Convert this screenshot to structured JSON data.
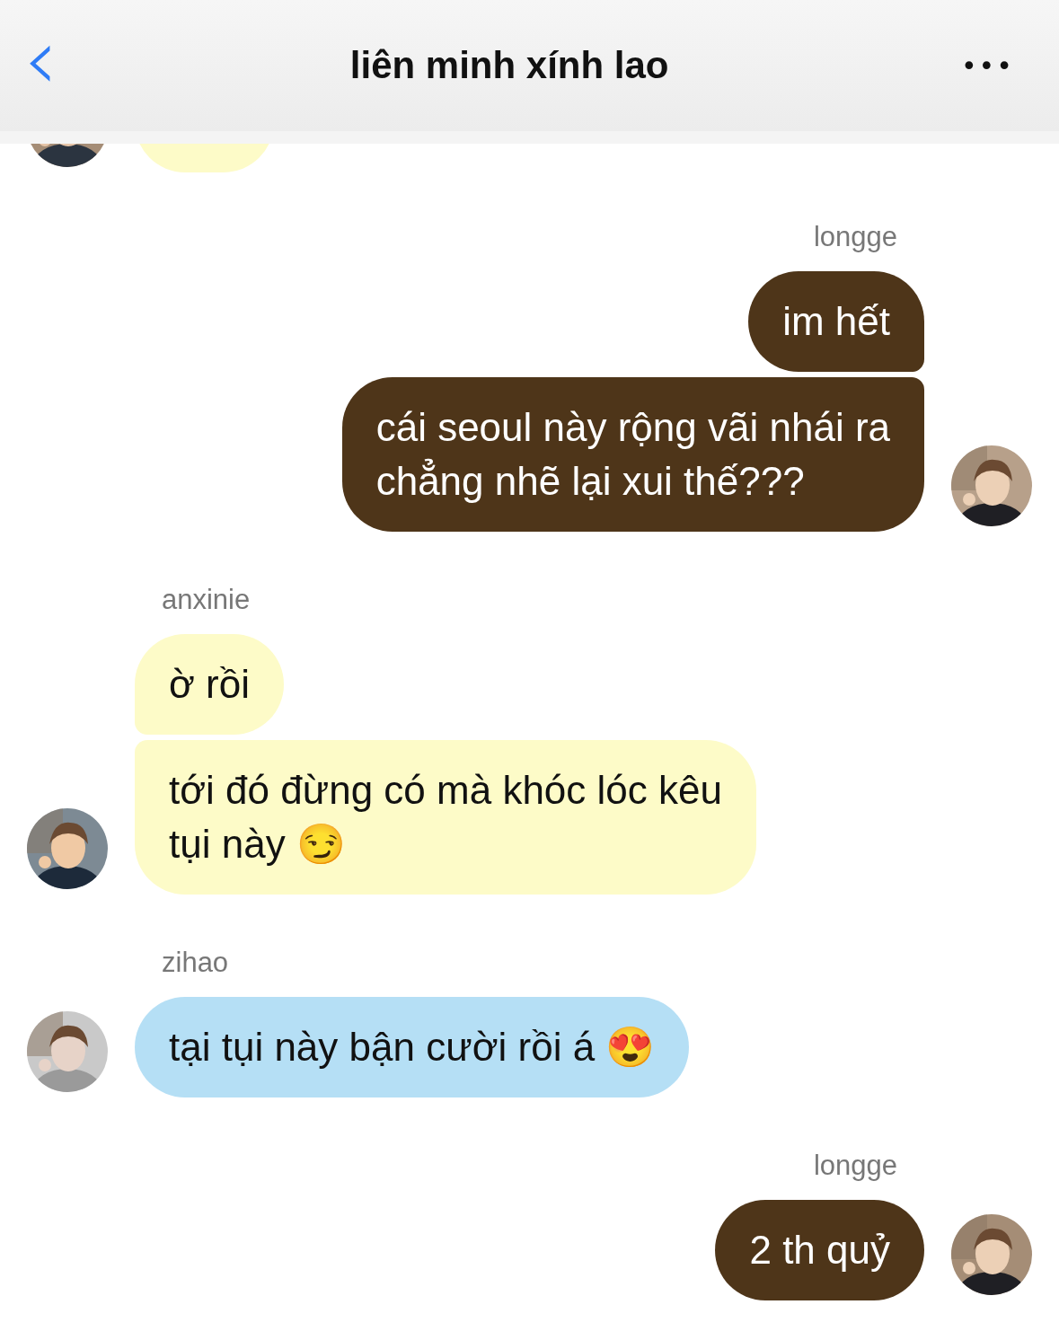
{
  "header": {
    "back": "‹",
    "title": "liên minh xính lao",
    "more": "•••"
  },
  "groups": [
    {
      "kind": "partial",
      "color": "#fdfbc8"
    },
    {
      "kind": "outgoing",
      "sender": "longge",
      "color": "#4e3519",
      "messages": [
        "im hết",
        "cái seoul này rộng vãi nhái ra\nchẳng nhẽ lại xui thế???"
      ]
    },
    {
      "kind": "incoming",
      "sender": "anxinie",
      "color": "#fdfbc8",
      "messages": [
        "ờ rồi",
        "tới đó đừng có mà khóc lóc kêu\ntụi này 😏"
      ]
    },
    {
      "kind": "incoming",
      "sender": "zihao",
      "color": "#b5dff5",
      "messages": [
        "tại tụi này bận cười rồi á 😍"
      ]
    },
    {
      "kind": "outgoing",
      "sender": "longge",
      "color": "#4e3519",
      "messages": [
        "2 th quỷ"
      ]
    }
  ]
}
